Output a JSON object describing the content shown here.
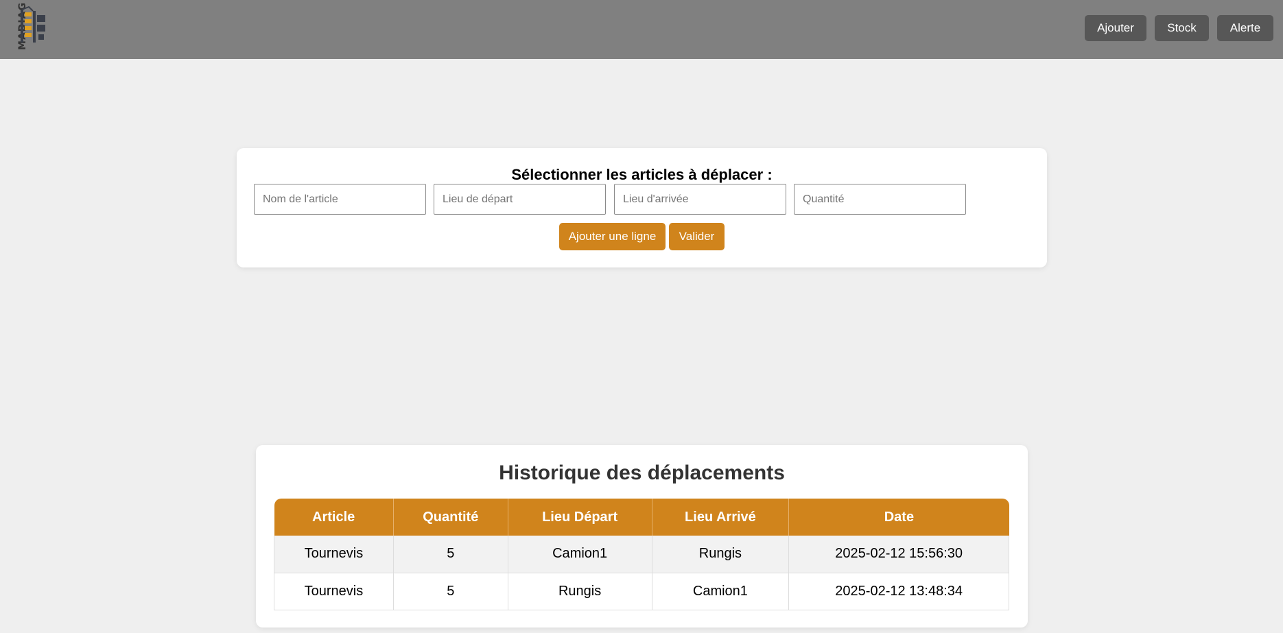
{
  "header": {
    "logo_text": "MADIAG",
    "nav": {
      "add_label": "Ajouter",
      "stock_label": "Stock",
      "alert_label": "Alerte"
    }
  },
  "move_form": {
    "title": "Sélectionner les articles à déplacer :",
    "article_placeholder": "Nom de l'article",
    "from_placeholder": "Lieu de départ",
    "to_placeholder": "Lieu d'arrivée",
    "quantity_placeholder": "Quantité",
    "add_line_label": "Ajouter une ligne",
    "validate_label": "Valider"
  },
  "history": {
    "title": "Historique des déplacements",
    "columns": [
      "Article",
      "Quantité",
      "Lieu Départ",
      "Lieu Arrivé",
      "Date"
    ],
    "rows": [
      [
        "Tournevis",
        "5",
        "Camion1",
        "Rungis",
        "2025-02-12 15:56:30"
      ],
      [
        "Tournevis",
        "5",
        "Rungis",
        "Camion1",
        "2025-02-12 13:48:34"
      ]
    ]
  },
  "colors": {
    "accent": "#d0841c",
    "topbar": "#808080",
    "nav_button": "#575757",
    "background": "#efefef"
  }
}
